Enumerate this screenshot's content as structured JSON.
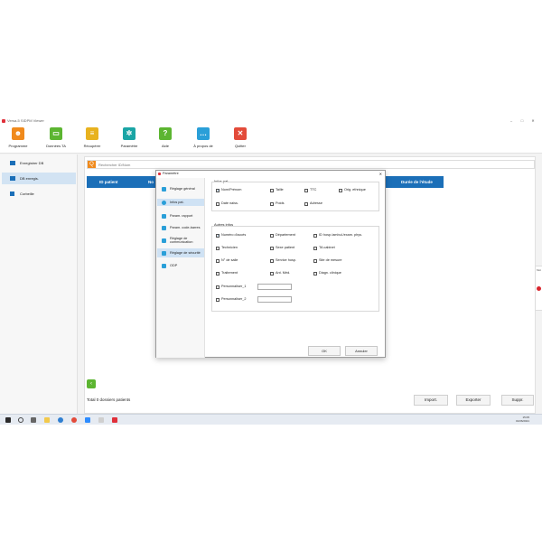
{
  "window": {
    "title": "Versa-5 SIDPM Viewer",
    "controls": [
      "–",
      "□",
      "✕"
    ]
  },
  "toolbar": {
    "items": [
      {
        "label": "Programme",
        "icon": "user-badge-icon",
        "color": "#f08a1c"
      },
      {
        "label": "Données TA",
        "icon": "folder-icon",
        "color": "#5cb531"
      },
      {
        "label": "Récupérer",
        "icon": "clipboard-icon",
        "color": "#e8b21f"
      },
      {
        "label": "Paramètre",
        "icon": "gear-icon",
        "color": "#1aa5a5"
      },
      {
        "label": "Aide",
        "icon": "help-icon",
        "color": "#5cb531"
      },
      {
        "label": "À propos de",
        "icon": "chat-icon",
        "color": "#2a9fd8"
      },
      {
        "label": "Quitter",
        "icon": "close-icon",
        "color": "#e34b3a"
      }
    ]
  },
  "sidebar": {
    "items": [
      {
        "label": "Enregistrer DB",
        "icon": "save-device-icon"
      },
      {
        "label": "DB enregis.",
        "icon": "database-folder-icon",
        "active": true
      },
      {
        "label": "Corbeille",
        "icon": "trash-icon"
      }
    ]
  },
  "search": {
    "placeholder": "Rechercher ID/Nom"
  },
  "table": {
    "columns": [
      "ID patient",
      "No",
      "Durée de l'étude"
    ]
  },
  "footer": {
    "total": "Total 0 dossiers patients",
    "buttons": [
      "Import.",
      "Exporter",
      "Suppr."
    ]
  },
  "peek": {
    "title": "Mot"
  },
  "tray": {
    "time": "15:05",
    "date": "01/06/2021",
    "glyphs": "^ ⊕ ◁"
  },
  "dialog": {
    "title": "Paramètre",
    "nav": [
      {
        "label": "Réglage général",
        "icon": "gear-icon",
        "color": "#2a9fd8"
      },
      {
        "label": "Infos pat.",
        "icon": "person-icon",
        "color": "#2a9fd8",
        "active": true
      },
      {
        "label": "Param. rapport",
        "icon": "document-icon",
        "color": "#2a9fd8"
      },
      {
        "label": "Param. code-barres",
        "icon": "barcode-icon",
        "color": "#2a9fd8"
      },
      {
        "label": "Réglage de communication",
        "icon": "network-icon",
        "color": "#2a9fd8"
      },
      {
        "label": "Réglage de sécurité",
        "icon": "shield-icon",
        "color": "#2a9fd8"
      },
      {
        "label": "ODP",
        "icon": "grid-icon",
        "color": "#2a9fd8"
      }
    ],
    "group1": {
      "label": "Infos pat.",
      "options": [
        {
          "label": "Nom/Prénom",
          "checked": true
        },
        {
          "label": "Taille",
          "checked": false
        },
        {
          "label": "TTC",
          "checked": false
        },
        {
          "label": "Orig. ethnique",
          "checked": false
        },
        {
          "label": "Date naiss.",
          "checked": false
        },
        {
          "label": "Poids",
          "checked": false
        },
        {
          "label": "Adresse",
          "checked": false
        }
      ]
    },
    "group2": {
      "label": "Autres infos",
      "options": [
        {
          "label": "Numéro d'accès",
          "checked": true
        },
        {
          "label": "Département",
          "checked": false
        },
        {
          "label": "ID hosp./ambul./exam. phys.",
          "checked": false
        },
        {
          "label": "Technicien",
          "checked": false
        },
        {
          "label": "Sexe patient",
          "checked": false
        },
        {
          "label": "TA cabinet",
          "checked": false
        },
        {
          "label": "N° de salle",
          "checked": false
        },
        {
          "label": "Service hosp.",
          "checked": false
        },
        {
          "label": "Site de mesure",
          "checked": false
        },
        {
          "label": "Traitement",
          "checked": false
        },
        {
          "label": "Ant. Méd.",
          "checked": false
        },
        {
          "label": "Diagn. clinique",
          "checked": false
        },
        {
          "label": "Personnaliser_1",
          "checked": false
        },
        {
          "label": "Personnaliser_2",
          "checked": false
        }
      ]
    },
    "buttons": {
      "ok": "OK",
      "cancel": "Annuler"
    },
    "close": "✕"
  }
}
